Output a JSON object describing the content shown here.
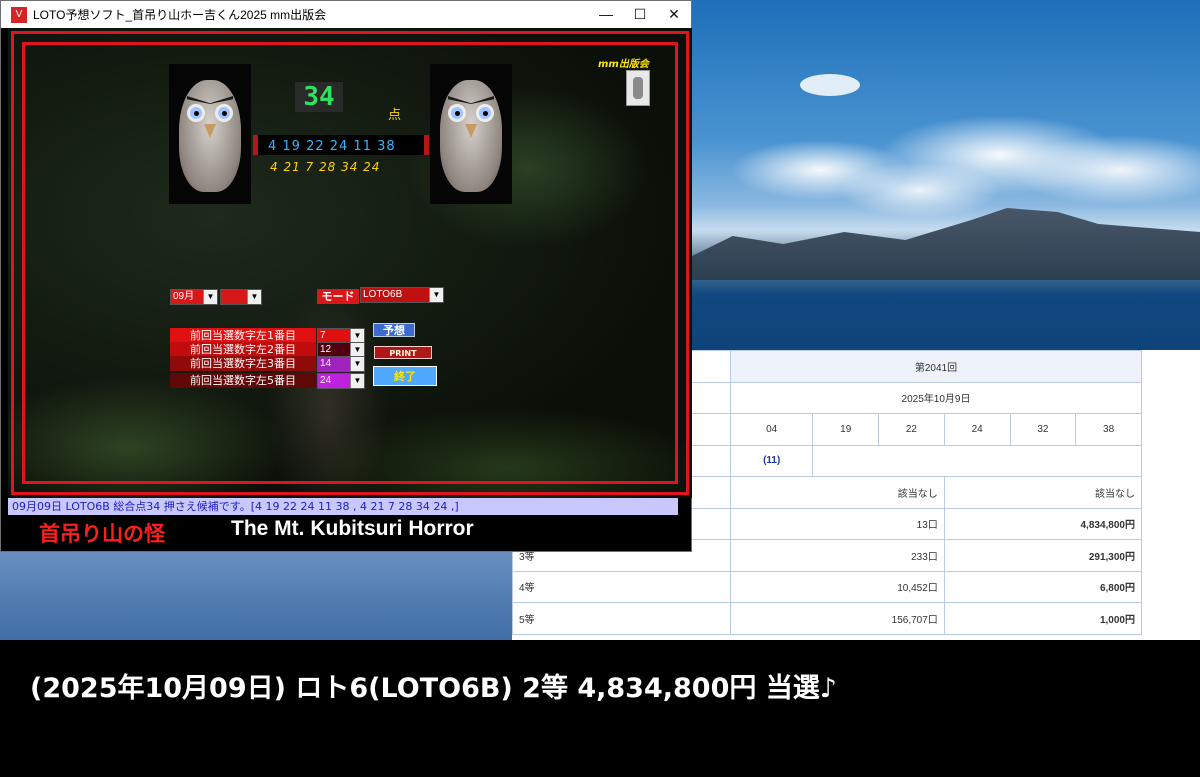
{
  "window": {
    "title": "LOTO予想ソフト_首吊り山ホー吉くん2025  mm出版会",
    "minimize_glyph": "—",
    "maximize_glyph": "☐",
    "close_glyph": "✕"
  },
  "app": {
    "score": "34",
    "score_unit": "点",
    "numbers_main": "4 19 22 24 11 38",
    "numbers_alt": "4 21 7 28 34 24",
    "publisher_logo": "mm出版会",
    "month_select": "09月",
    "day_select": "",
    "mode_label": "モード",
    "mode_select": "LOTO6B",
    "prev_labels": [
      "前回当選数字左1番目",
      "前回当選数字左2番目",
      "前回当選数字左3番目",
      "前回当選数字左5番目"
    ],
    "prev_values": [
      "7",
      "12",
      "14",
      "24"
    ],
    "predict_button": "予想",
    "print_button": "PRINT",
    "exit_button": "終了",
    "status_text": "09月09日 LOTO6B  総合点34  押さえ候補です。[4 19 22 24 11 38 , 4 21 7 28 34 24 ,]",
    "title_jp": "首吊り山の怪",
    "title_en": "The Mt. Kubitsuri Horror"
  },
  "results": {
    "round": "第2041回",
    "date": "2025年10月9日",
    "main_numbers": [
      "04",
      "19",
      "22",
      "24",
      "32",
      "38"
    ],
    "bonus": "(11)",
    "prizes": [
      {
        "rank": "",
        "winners": "該当なし",
        "amount": "該当なし"
      },
      {
        "rank": "",
        "winners": "13口",
        "amount": "4,834,800円"
      },
      {
        "rank": "3等",
        "winners": "233口",
        "amount": "291,300円"
      },
      {
        "rank": "4等",
        "winners": "10,452口",
        "amount": "6,800円"
      },
      {
        "rank": "5等",
        "winners": "156,707口",
        "amount": "1,000円"
      }
    ]
  },
  "banner": {
    "text": "(2025年10月09日) ロト6(LOTO6B)  2等  4,834,800円 当選♪"
  }
}
